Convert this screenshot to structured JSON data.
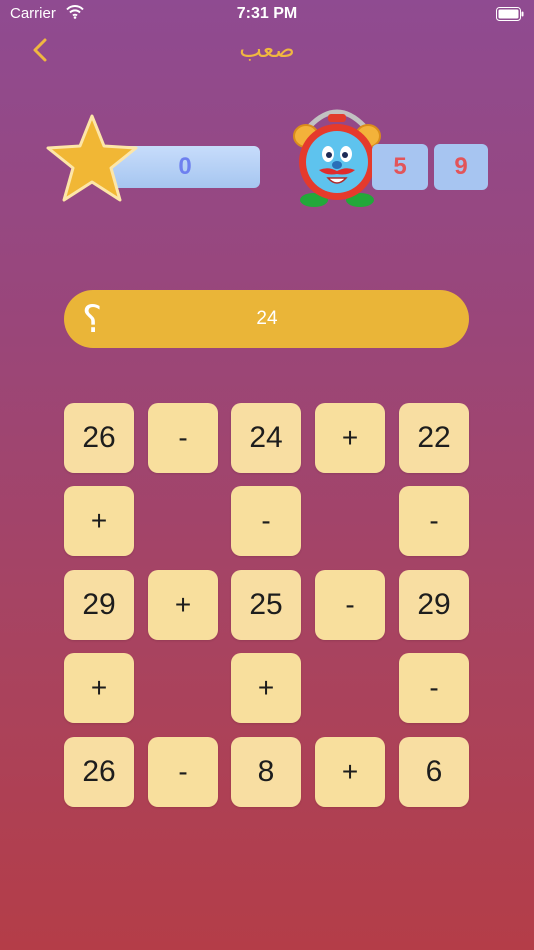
{
  "status": {
    "carrier": "Carrier",
    "time": "7:31 PM"
  },
  "nav": {
    "title": "صعب"
  },
  "score": {
    "value": "0"
  },
  "timer": {
    "digit1": "5",
    "digit2": "9"
  },
  "target": {
    "question_mark": "؟",
    "value": "24"
  },
  "grid": [
    [
      "26",
      "-",
      "24",
      "+",
      "22"
    ],
    [
      "+",
      "",
      "-",
      "",
      "-"
    ],
    [
      "29",
      "+",
      "25",
      "-",
      "29"
    ],
    [
      "+",
      "",
      "+",
      "",
      "-"
    ],
    [
      "26",
      "-",
      "8",
      "+",
      "6"
    ]
  ],
  "colors": {
    "accent": "#f0b740",
    "cell": "#f8dea2",
    "score_text": "#6e80ef",
    "timer_text": "#e2555a"
  }
}
